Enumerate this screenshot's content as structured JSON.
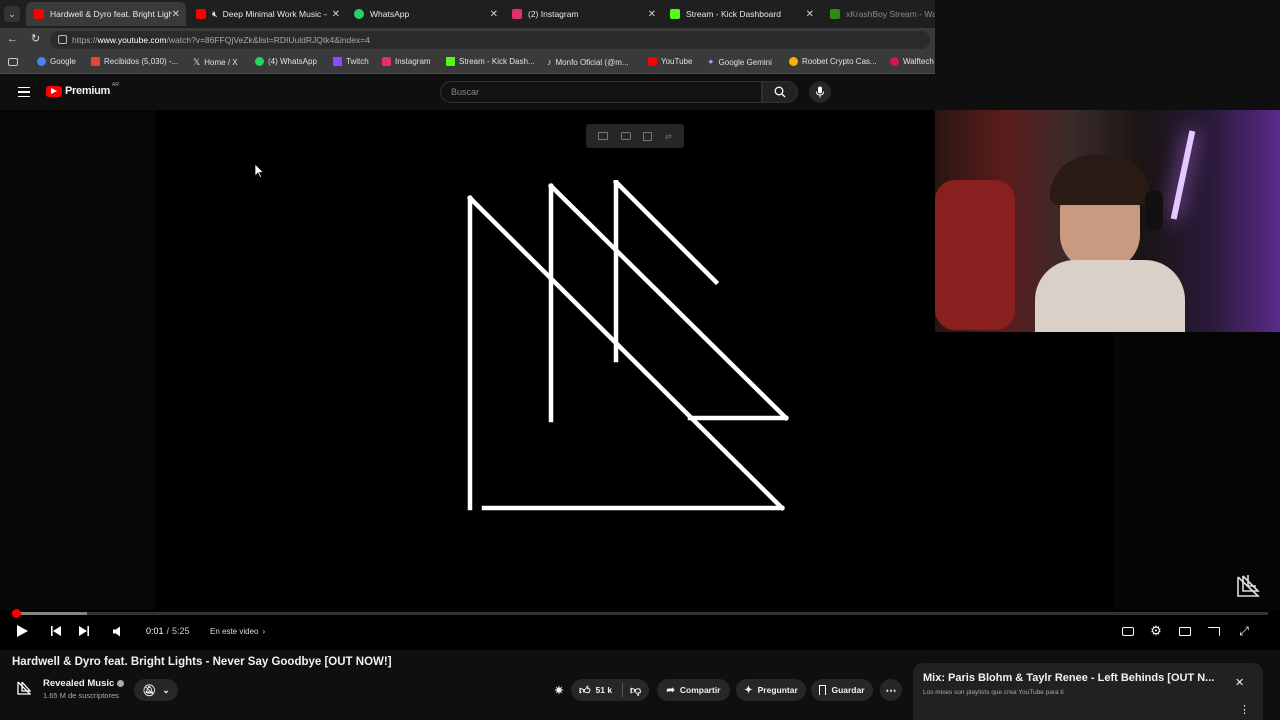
{
  "browser": {
    "tabs": [
      {
        "label": "Hardwell & Dyro feat. Bright Light",
        "color": "#ff0000",
        "active": true
      },
      {
        "label": "Deep Minimal Work Music —",
        "color": "#ff0000",
        "muted": true
      },
      {
        "label": "WhatsApp",
        "color": "#25d366"
      },
      {
        "label": "(2) Instagram",
        "color": "#e1306c"
      },
      {
        "label": "Stream - Kick Dashboard",
        "color": "#53fc18"
      },
      {
        "label": "xKrashBoy Stream - Watch",
        "color": "#53fc18"
      }
    ],
    "url_prefix": "https://",
    "url_domain": "www.youtube.com",
    "url_path": "/watch?v=86FFQjVeZk&list=RDIUuldRJQtk4&index=4",
    "bookmarks": [
      {
        "label": "Google",
        "color": "#4285f4"
      },
      {
        "label": "Recibidos (5,030) -...",
        "color": "#ea4335"
      },
      {
        "label": "Home / X",
        "color": "#ffffff"
      },
      {
        "label": "(4) WhatsApp",
        "color": "#25d366"
      },
      {
        "label": "Twitch",
        "color": "#9146ff"
      },
      {
        "label": "Instagram",
        "color": "#e1306c"
      },
      {
        "label": "Stream - Kick Dash...",
        "color": "#53fc18"
      },
      {
        "label": "Monfo Oficial (@m...",
        "color": "#ffffff"
      },
      {
        "label": "YouTube",
        "color": "#ff0000"
      },
      {
        "label": "Google Gemini",
        "color": "#8ab4f8"
      },
      {
        "label": "Roobet Crypto Cas...",
        "color": "#f5b400"
      },
      {
        "label": "Walftech",
        "color": "#d4145a"
      }
    ]
  },
  "youtube": {
    "logo_text": "Premium",
    "region": "AR",
    "search_placeholder": "Buscar",
    "brand_color": "#ff0000"
  },
  "player": {
    "time_current": "0:01",
    "time_separator": "/",
    "time_total": "5:25",
    "chapter_label": "En este video",
    "played_fraction": 0.003,
    "loaded_fraction": 0.06
  },
  "video_info": {
    "title": "Hardwell & Dyro feat. Bright Lights - Never Say Goodbye [OUT NOW!]",
    "channel_name": "Revealed Music",
    "subscribers": "1.65 M de suscriptores",
    "likes": "51 k",
    "share_label": "Compartir",
    "ask_label": "Preguntar",
    "save_label": "Guardar"
  },
  "mix_panel": {
    "title": "Mix: Paris Blohm & Taylr Renee - Left Behinds [OUT N...",
    "subtitle": "Los mixes son playlists que crea YouTube para ti"
  }
}
